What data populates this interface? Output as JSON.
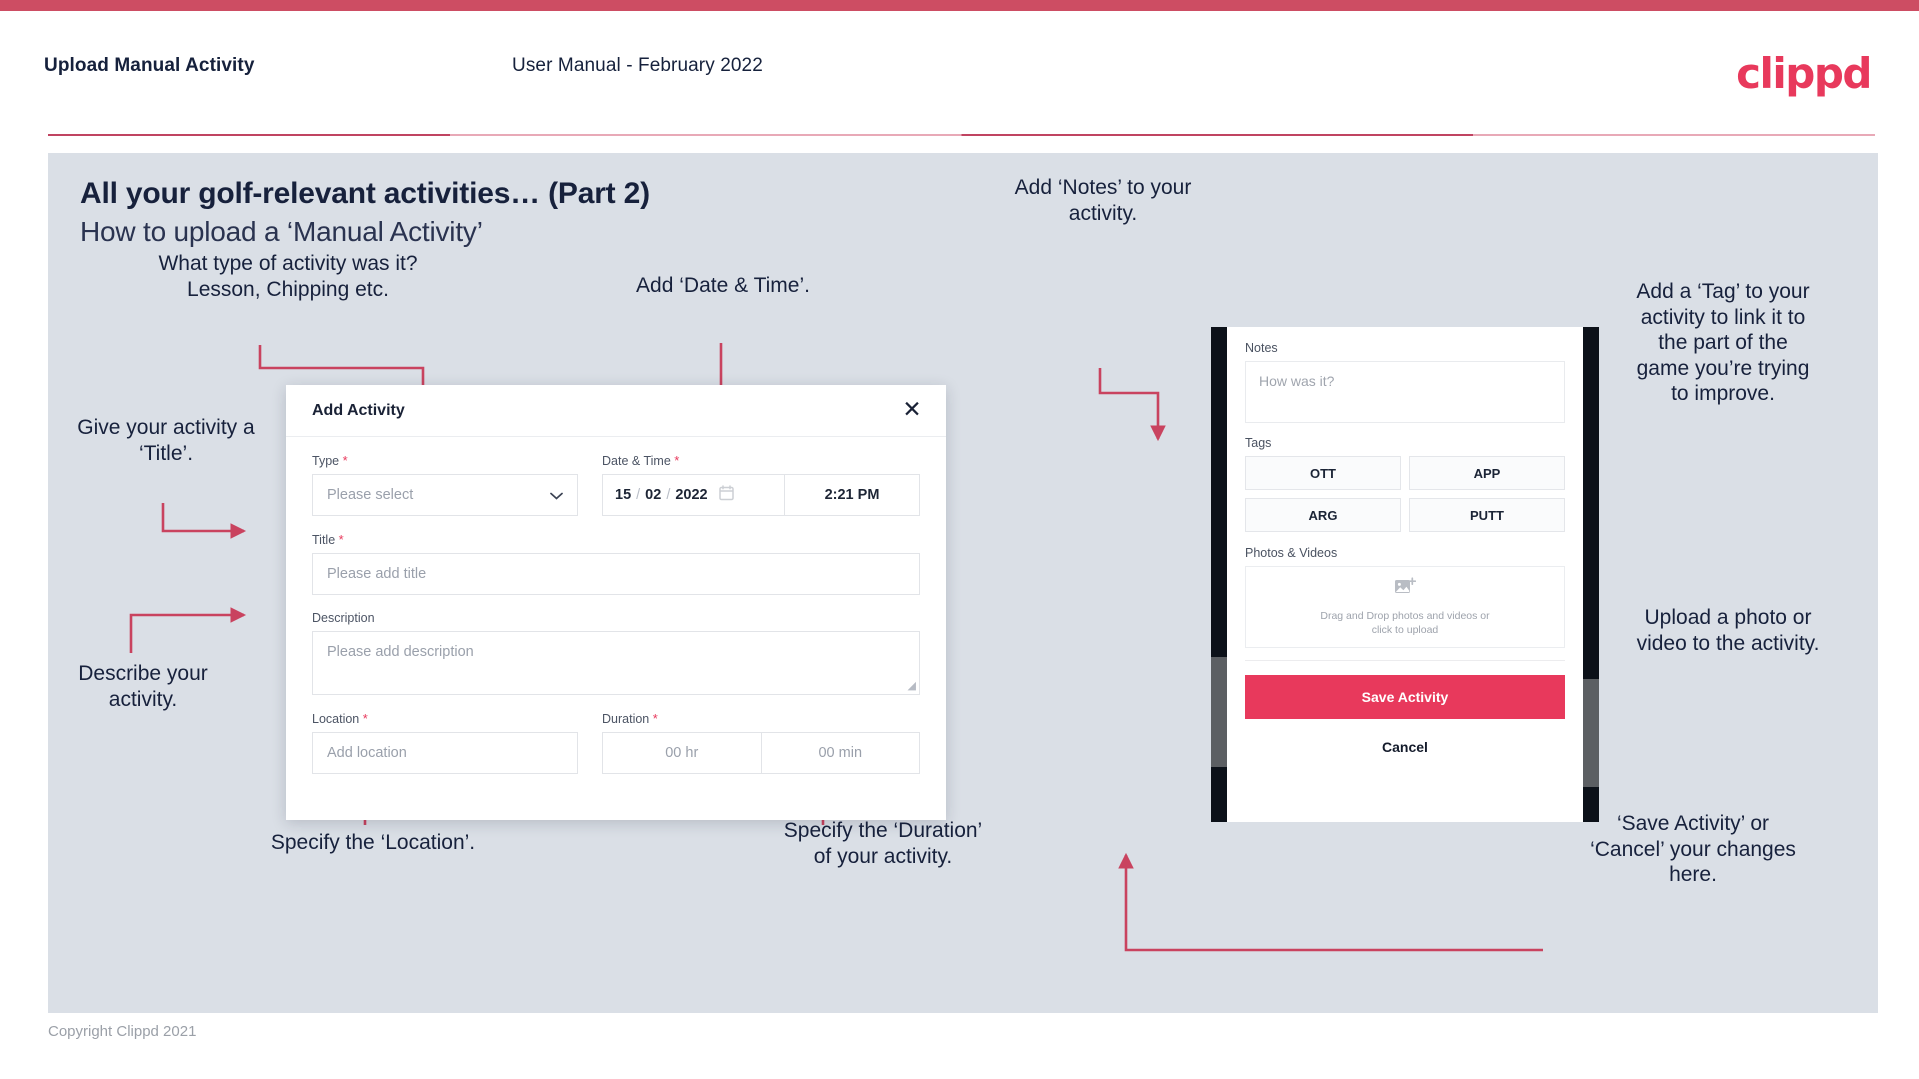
{
  "header": {
    "title": "Upload Manual Activity",
    "subtitle": "User Manual - February 2022",
    "logo": "clippd"
  },
  "slide": {
    "title": "All your golf-relevant activities… (Part 2)",
    "subtitle": "How to upload a ‘Manual Activity’"
  },
  "annotations": {
    "type": "What type of activity was it?\nLesson, Chipping etc.",
    "datetime": "Add ‘Date & Time’.",
    "title": "Give your activity a\n‘Title’.",
    "description": "Describe your\nactivity.",
    "location": "Specify the ‘Location’.",
    "duration": "Specify the ‘Duration’\nof your activity.",
    "notes": "Add ‘Notes’ to your\nactivity.",
    "tags": "Add a ‘Tag’ to your\nactivity to link it to\nthe part of the\ngame you’re trying\nto improve.",
    "photos": "Upload a photo or\nvideo to the activity.",
    "save": "‘Save Activity’ or\n‘Cancel’ your changes\nhere."
  },
  "dialog": {
    "title": "Add Activity",
    "close_icon": "close-icon",
    "fields": {
      "type": {
        "label": "Type",
        "required": "*",
        "placeholder": "Please select",
        "chevron": "chevron-down-icon"
      },
      "datetime": {
        "label": "Date & Time",
        "required": "*",
        "day": "15",
        "sep1": "/",
        "month": "02",
        "sep2": "/",
        "year": "2022",
        "calendar_icon": "calendar-icon",
        "time": "2:21 PM"
      },
      "title": {
        "label": "Title",
        "required": "*",
        "placeholder": "Please add title"
      },
      "description": {
        "label": "Description",
        "required": "",
        "placeholder": "Please add description"
      },
      "location": {
        "label": "Location",
        "required": "*",
        "placeholder": "Add location"
      },
      "duration": {
        "label": "Duration",
        "required": "*",
        "hours": "00 hr",
        "minutes": "00 min"
      }
    }
  },
  "phone": {
    "notes": {
      "label": "Notes",
      "placeholder": "How was it?"
    },
    "tags": {
      "label": "Tags",
      "items": [
        {
          "label": "OTT"
        },
        {
          "label": "APP"
        },
        {
          "label": "ARG"
        },
        {
          "label": "PUTT"
        }
      ]
    },
    "photos": {
      "label": "Photos & Videos",
      "icon": "image-add-icon",
      "line1": "Drag and Drop photos and videos or",
      "line2": "click to upload"
    },
    "save_label": "Save Activity",
    "cancel_label": "Cancel"
  },
  "footer": {
    "copyright": "Copyright Clippd 2021"
  },
  "colors": {
    "brand": "#e8395c",
    "top_bar": "#cd4d63",
    "slide_bg": "#dadfe6",
    "text_dark": "#17213c",
    "connector": "#c9435f"
  }
}
